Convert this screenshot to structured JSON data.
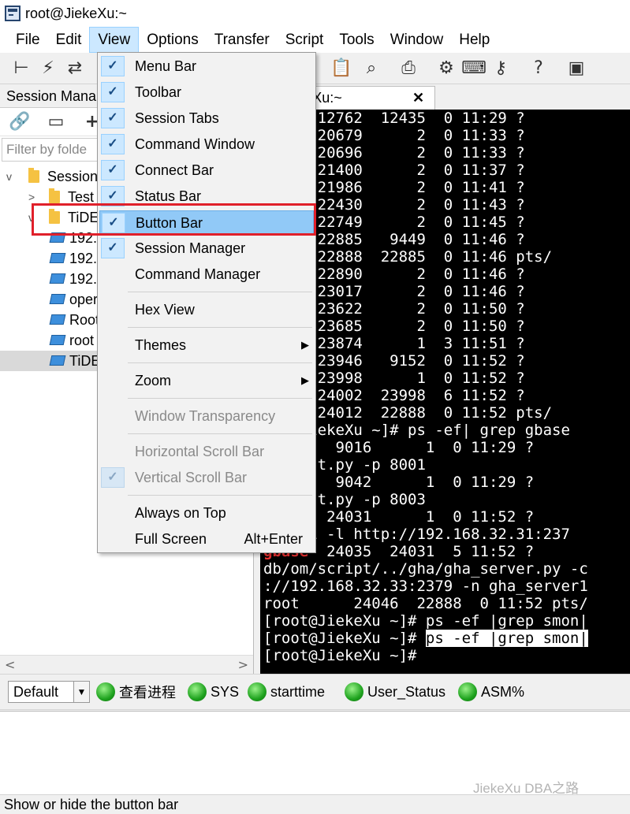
{
  "window": {
    "title": "root@JiekeXu:~"
  },
  "menubar": {
    "items": [
      "File",
      "Edit",
      "View",
      "Options",
      "Transfer",
      "Script",
      "Tools",
      "Window",
      "Help"
    ],
    "active": "View"
  },
  "toolbar": {
    "icons": [
      "connect-tree-icon",
      "lightning-icon",
      "reconnect-icon",
      "copy-icon",
      "paste-icon",
      "find-binoculars-icon",
      "print-icon",
      "settings-gear-icon",
      "keymap-icon",
      "key-icon",
      "help-icon",
      "screen-lock-icon"
    ]
  },
  "session_manager": {
    "title": "Session Mana",
    "filter_placeholder": "Filter by folde",
    "tree": [
      {
        "label": "Session",
        "kind": "folder",
        "expanded": true
      },
      {
        "label": "Test",
        "kind": "folder",
        "expanded": false
      },
      {
        "label": "TiDE",
        "kind": "folder",
        "expanded": true
      },
      {
        "label": "192.",
        "kind": "session"
      },
      {
        "label": "192.",
        "kind": "session"
      },
      {
        "label": "192.",
        "kind": "session"
      },
      {
        "label": "oper",
        "kind": "session"
      },
      {
        "label": "Root",
        "kind": "session"
      },
      {
        "label": "root",
        "kind": "session"
      },
      {
        "label": "TiDE",
        "kind": "session",
        "selected": true
      }
    ]
  },
  "session_tab": {
    "label": "t@JiekeXu:~",
    "close": "✕"
  },
  "terminal": {
    "lines": [
      "      12762  12435  0 11:29 ?",
      "      20679      2  0 11:33 ?",
      "      20696      2  0 11:33 ?",
      "      21400      2  0 11:37 ?",
      "      21986      2  0 11:41 ?",
      "      22430      2  0 11:43 ?",
      "      22749      2  0 11:45 ?",
      "      22885   9449  0 11:46 ?",
      "      22888  22885  0 11:46 pts/",
      "      22890      2  0 11:46 ?",
      "      23017      2  0 11:46 ?",
      "      23622      2  0 11:50 ?",
      "      23685      2  0 11:50 ?",
      "      23874      1  3 11:51 ?",
      "      23946   9152  0 11:52 ?",
      "      23998      1  0 11:52 ?",
      "      24002  23998  6 11:52 ?",
      "      24012  22888  0 11:52 pts/",
      "   @JiekeXu ~]# ps -ef| grep gbase",
      "        9016      1  0 11:29 ?",
      "   gent.py -p 8001",
      "        9042      1  0 11:29 ?",
      "   gent.py -p 8003",
      "       24031      1  0 11:52 ?",
      "   001 -l http://192.168.32.31:237",
      "       24035  24031  5 11:52 ?",
      "db/om/script/../gha/gha_server.py -c",
      "://192.168.32.33:2379 -n gha_server1",
      "root      24046  22888  0 11:52 pts/",
      "[root@JiekeXu ~]# ps -ef |grep smon|",
      "[root@JiekeXu ~]# ",
      "[root@JiekeXu ~]#"
    ],
    "highlight_text": "ps -ef |grep smon|",
    "red_fragment": "gbase"
  },
  "view_menu": {
    "items": [
      {
        "label": "Menu Bar",
        "checked": true
      },
      {
        "label": "Toolbar",
        "checked": true
      },
      {
        "label": "Session Tabs",
        "checked": true
      },
      {
        "label": "Command Window",
        "checked": true
      },
      {
        "label": "Connect Bar",
        "checked": true
      },
      {
        "label": "Status Bar",
        "checked": true
      },
      {
        "label": "Button Bar",
        "checked": true,
        "highlighted": true
      },
      {
        "label": "Session Manager",
        "checked": true
      },
      {
        "label": "Command Manager",
        "checked": false
      },
      {
        "label": "Hex View",
        "checked": false
      },
      {
        "label": "Themes",
        "submenu": true
      },
      {
        "label": "Zoom",
        "submenu": true
      },
      {
        "label": "Window Transparency",
        "disabled": true
      },
      {
        "label": "Horizontal Scroll Bar",
        "disabled": true
      },
      {
        "label": "Vertical Scroll Bar",
        "disabled": true,
        "checked": true
      },
      {
        "label": "Always on Top",
        "checked": false
      },
      {
        "label": "Full Screen",
        "accelerator": "Alt+Enter"
      }
    ]
  },
  "button_bar": {
    "combo_value": "Default",
    "buttons": [
      "查看进程",
      "SYS",
      "starttime",
      "User_Status",
      "ASM%"
    ]
  },
  "watermark": "JiekeXu DBA之路",
  "status_bar": {
    "text": "Show or hide the button bar"
  },
  "colors": {
    "menu_active": "#cce8ff",
    "highlight": "#91c9f7",
    "red_box": "#e0202a",
    "green_button": "#1fa31f",
    "terminal_bg": "#000000"
  }
}
